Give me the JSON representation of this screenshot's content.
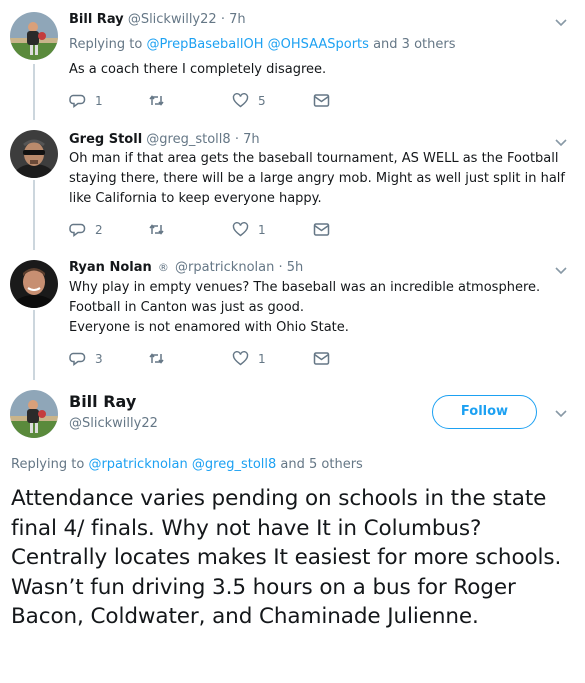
{
  "replies": [
    {
      "name": "Bill Ray",
      "handle": "@Slickwilly22",
      "time": "· 7h",
      "replying_prefix": "Replying to",
      "replying_users": [
        "@PrepBaseballOH",
        "@OHSAASports"
      ],
      "replying_suffix": "and 3 others",
      "text": [
        "As a coach there I completely disagree."
      ],
      "counts": {
        "reply": "1",
        "retweet": "",
        "like": "5"
      }
    },
    {
      "name": "Greg Stoll",
      "handle": "@greg_stoll8",
      "time": "· 7h",
      "text": [
        "Oh man if that area gets the baseball tournament, AS WELL as the Football staying there, there will be a large angry mob. Might as well just split in half like California to keep everyone happy."
      ],
      "counts": {
        "reply": "2",
        "retweet": "",
        "like": "1"
      }
    },
    {
      "name": "Ryan Nolan",
      "handle": "@rpatricknolan",
      "time": "· 5h",
      "text": [
        "Why play in empty venues? The baseball was an incredible atmosphere. Football in Canton was just as good.",
        "Everyone is not enamored with Ohio State."
      ],
      "counts": {
        "reply": "3",
        "retweet": "",
        "like": "1"
      }
    }
  ],
  "main_tweet": {
    "name": "Bill Ray",
    "handle": "@Slickwilly22",
    "follow_label": "Follow",
    "replying_prefix": "Replying to",
    "replying_users": [
      "@rpatricknolan",
      "@greg_stoll8"
    ],
    "replying_suffix": "and 5 others",
    "text": "Attendance varies pending on schools in the state final 4/ finals. Why not have It in Columbus? Centrally locates makes It easiest for more schools. Wasn’t fun driving 3.5 hours on a bus for Roger Bacon, Coldwater, and Chaminade Julienne."
  },
  "icons": {
    "reply": "reply-icon",
    "retweet": "retweet-icon",
    "like": "heart-icon",
    "dm": "envelope-icon",
    "more": "chevron-down-icon",
    "verified": "verified-badge-icon"
  },
  "colors": {
    "link": "#1da1f2",
    "muted": "#657786",
    "text": "#14171a",
    "thread_line": "#ccd6dd"
  }
}
